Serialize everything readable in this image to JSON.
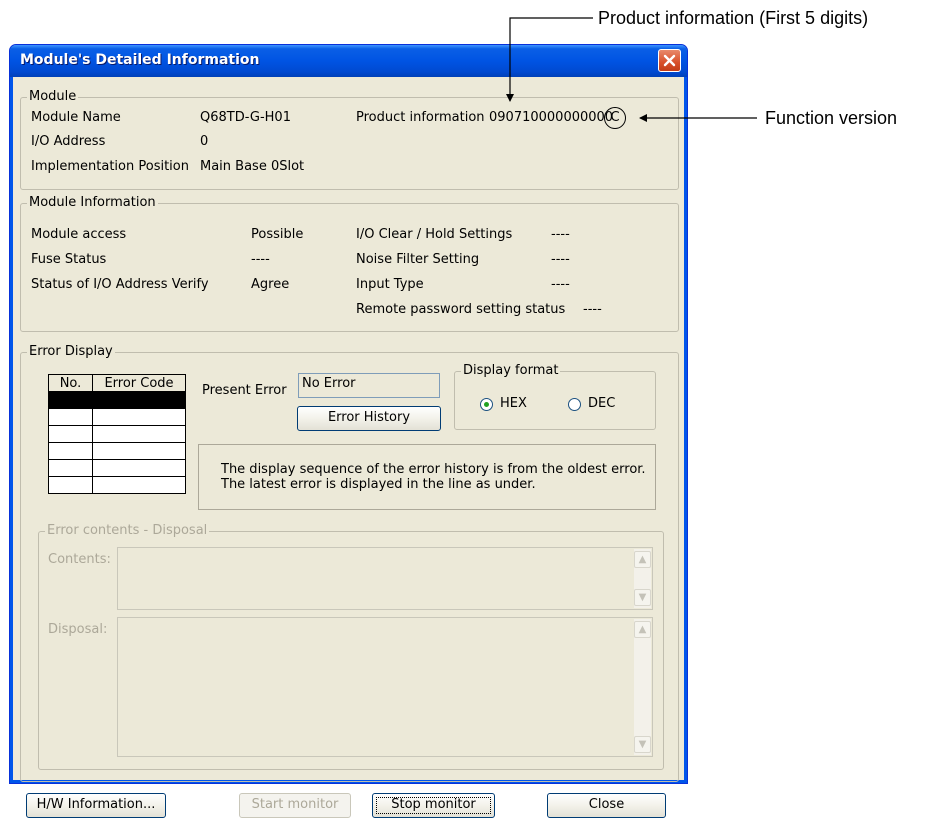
{
  "annotations": {
    "product_info": "Product information (First 5 digits)",
    "function_version": "Function version"
  },
  "window": {
    "title": "Module's Detailed Information"
  },
  "module": {
    "legend": "Module",
    "name_label": "Module Name",
    "name_value": "Q68TD-G-H01",
    "io_label": "I/O Address",
    "io_value": "0",
    "impl_label": "Implementation Position",
    "impl_value": "Main Base  0Slot",
    "product_label": "Product information",
    "product_value": "090710000000000",
    "function_version": "C"
  },
  "module_info": {
    "legend": "Module Information",
    "access_label": "Module access",
    "access_value": "Possible",
    "fuse_label": "Fuse Status",
    "fuse_value": "----",
    "verify_label": "Status of I/O Address Verify",
    "verify_value": "Agree",
    "clear_label": "I/O Clear / Hold Settings",
    "clear_value": "----",
    "noise_label": "Noise Filter Setting",
    "noise_value": "----",
    "input_label": "Input Type",
    "input_value": "----",
    "remote_label": "Remote password setting status",
    "remote_value": "----"
  },
  "error_display": {
    "legend": "Error Display",
    "table_headers": [
      "No.",
      "Error Code"
    ],
    "present_label": "Present Error",
    "present_value": "No Error",
    "history_button": "Error History",
    "format_legend": "Display format",
    "format_hex": "HEX",
    "format_dec": "DEC",
    "format_selected": "HEX",
    "note_line1": "The display sequence of the error history is from the oldest error.",
    "note_line2": "The latest error is displayed in the line as under."
  },
  "error_contents": {
    "legend": "Error contents - Disposal",
    "contents_label": "Contents:",
    "disposal_label": "Disposal:"
  },
  "footer": {
    "hw_button": "H/W Information...",
    "start_button": "Start monitor",
    "stop_button": "Stop monitor",
    "close_button": "Close"
  },
  "colors": {
    "titlebar": "#0054e3",
    "dialog_bg": "#ece9d8",
    "close_button": "#d8502a"
  }
}
